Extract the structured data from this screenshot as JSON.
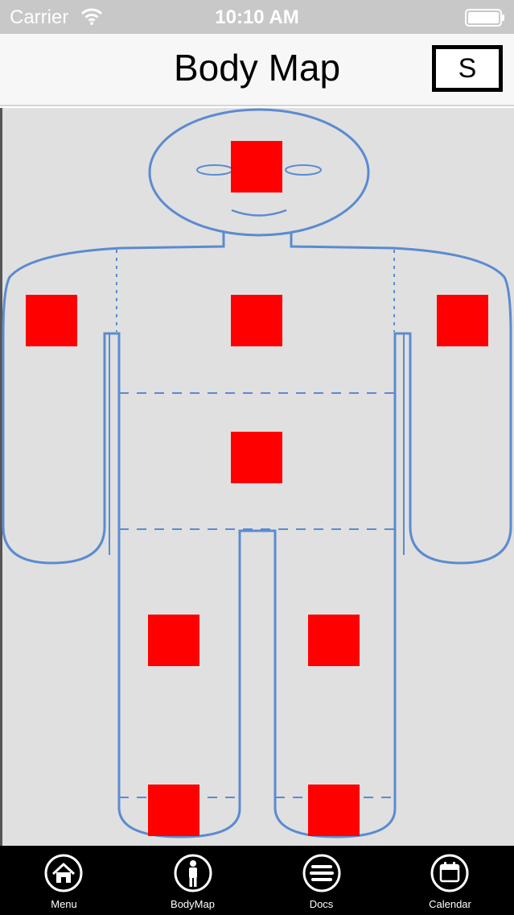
{
  "status_bar": {
    "carrier": "Carrier",
    "time": "10:10 AM"
  },
  "nav": {
    "title": "Body Map",
    "s_button_label": "S"
  },
  "body_map": {
    "hotspot_color": "#ff0000",
    "outline_color": "#5b8bd0",
    "background_color": "#e0e0e0",
    "regions": [
      "head",
      "right-upper-arm",
      "chest",
      "left-upper-arm",
      "abdomen",
      "right-thigh",
      "left-thigh",
      "right-lower-leg",
      "left-lower-leg"
    ]
  },
  "tab_bar": {
    "tabs": [
      {
        "label": "Menu",
        "icon": "home-icon"
      },
      {
        "label": "BodyMap",
        "icon": "person-icon"
      },
      {
        "label": "Docs",
        "icon": "list-icon"
      },
      {
        "label": "Calendar",
        "icon": "calendar-icon"
      }
    ]
  }
}
